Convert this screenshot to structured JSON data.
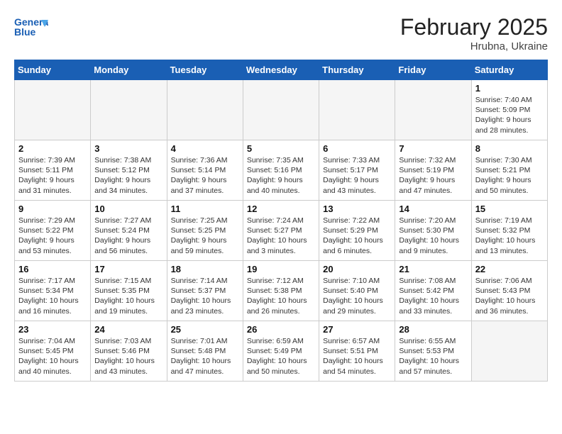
{
  "header": {
    "logo_text_general": "General",
    "logo_text_blue": "Blue",
    "month": "February 2025",
    "location": "Hrubna, Ukraine"
  },
  "days_of_week": [
    "Sunday",
    "Monday",
    "Tuesday",
    "Wednesday",
    "Thursday",
    "Friday",
    "Saturday"
  ],
  "weeks": [
    [
      {
        "day": "",
        "info": ""
      },
      {
        "day": "",
        "info": ""
      },
      {
        "day": "",
        "info": ""
      },
      {
        "day": "",
        "info": ""
      },
      {
        "day": "",
        "info": ""
      },
      {
        "day": "",
        "info": ""
      },
      {
        "day": "1",
        "info": "Sunrise: 7:40 AM\nSunset: 5:09 PM\nDaylight: 9 hours and 28 minutes."
      }
    ],
    [
      {
        "day": "2",
        "info": "Sunrise: 7:39 AM\nSunset: 5:11 PM\nDaylight: 9 hours and 31 minutes."
      },
      {
        "day": "3",
        "info": "Sunrise: 7:38 AM\nSunset: 5:12 PM\nDaylight: 9 hours and 34 minutes."
      },
      {
        "day": "4",
        "info": "Sunrise: 7:36 AM\nSunset: 5:14 PM\nDaylight: 9 hours and 37 minutes."
      },
      {
        "day": "5",
        "info": "Sunrise: 7:35 AM\nSunset: 5:16 PM\nDaylight: 9 hours and 40 minutes."
      },
      {
        "day": "6",
        "info": "Sunrise: 7:33 AM\nSunset: 5:17 PM\nDaylight: 9 hours and 43 minutes."
      },
      {
        "day": "7",
        "info": "Sunrise: 7:32 AM\nSunset: 5:19 PM\nDaylight: 9 hours and 47 minutes."
      },
      {
        "day": "8",
        "info": "Sunrise: 7:30 AM\nSunset: 5:21 PM\nDaylight: 9 hours and 50 minutes."
      }
    ],
    [
      {
        "day": "9",
        "info": "Sunrise: 7:29 AM\nSunset: 5:22 PM\nDaylight: 9 hours and 53 minutes."
      },
      {
        "day": "10",
        "info": "Sunrise: 7:27 AM\nSunset: 5:24 PM\nDaylight: 9 hours and 56 minutes."
      },
      {
        "day": "11",
        "info": "Sunrise: 7:25 AM\nSunset: 5:25 PM\nDaylight: 9 hours and 59 minutes."
      },
      {
        "day": "12",
        "info": "Sunrise: 7:24 AM\nSunset: 5:27 PM\nDaylight: 10 hours and 3 minutes."
      },
      {
        "day": "13",
        "info": "Sunrise: 7:22 AM\nSunset: 5:29 PM\nDaylight: 10 hours and 6 minutes."
      },
      {
        "day": "14",
        "info": "Sunrise: 7:20 AM\nSunset: 5:30 PM\nDaylight: 10 hours and 9 minutes."
      },
      {
        "day": "15",
        "info": "Sunrise: 7:19 AM\nSunset: 5:32 PM\nDaylight: 10 hours and 13 minutes."
      }
    ],
    [
      {
        "day": "16",
        "info": "Sunrise: 7:17 AM\nSunset: 5:34 PM\nDaylight: 10 hours and 16 minutes."
      },
      {
        "day": "17",
        "info": "Sunrise: 7:15 AM\nSunset: 5:35 PM\nDaylight: 10 hours and 19 minutes."
      },
      {
        "day": "18",
        "info": "Sunrise: 7:14 AM\nSunset: 5:37 PM\nDaylight: 10 hours and 23 minutes."
      },
      {
        "day": "19",
        "info": "Sunrise: 7:12 AM\nSunset: 5:38 PM\nDaylight: 10 hours and 26 minutes."
      },
      {
        "day": "20",
        "info": "Sunrise: 7:10 AM\nSunset: 5:40 PM\nDaylight: 10 hours and 29 minutes."
      },
      {
        "day": "21",
        "info": "Sunrise: 7:08 AM\nSunset: 5:42 PM\nDaylight: 10 hours and 33 minutes."
      },
      {
        "day": "22",
        "info": "Sunrise: 7:06 AM\nSunset: 5:43 PM\nDaylight: 10 hours and 36 minutes."
      }
    ],
    [
      {
        "day": "23",
        "info": "Sunrise: 7:04 AM\nSunset: 5:45 PM\nDaylight: 10 hours and 40 minutes."
      },
      {
        "day": "24",
        "info": "Sunrise: 7:03 AM\nSunset: 5:46 PM\nDaylight: 10 hours and 43 minutes."
      },
      {
        "day": "25",
        "info": "Sunrise: 7:01 AM\nSunset: 5:48 PM\nDaylight: 10 hours and 47 minutes."
      },
      {
        "day": "26",
        "info": "Sunrise: 6:59 AM\nSunset: 5:49 PM\nDaylight: 10 hours and 50 minutes."
      },
      {
        "day": "27",
        "info": "Sunrise: 6:57 AM\nSunset: 5:51 PM\nDaylight: 10 hours and 54 minutes."
      },
      {
        "day": "28",
        "info": "Sunrise: 6:55 AM\nSunset: 5:53 PM\nDaylight: 10 hours and 57 minutes."
      },
      {
        "day": "",
        "info": ""
      }
    ]
  ]
}
